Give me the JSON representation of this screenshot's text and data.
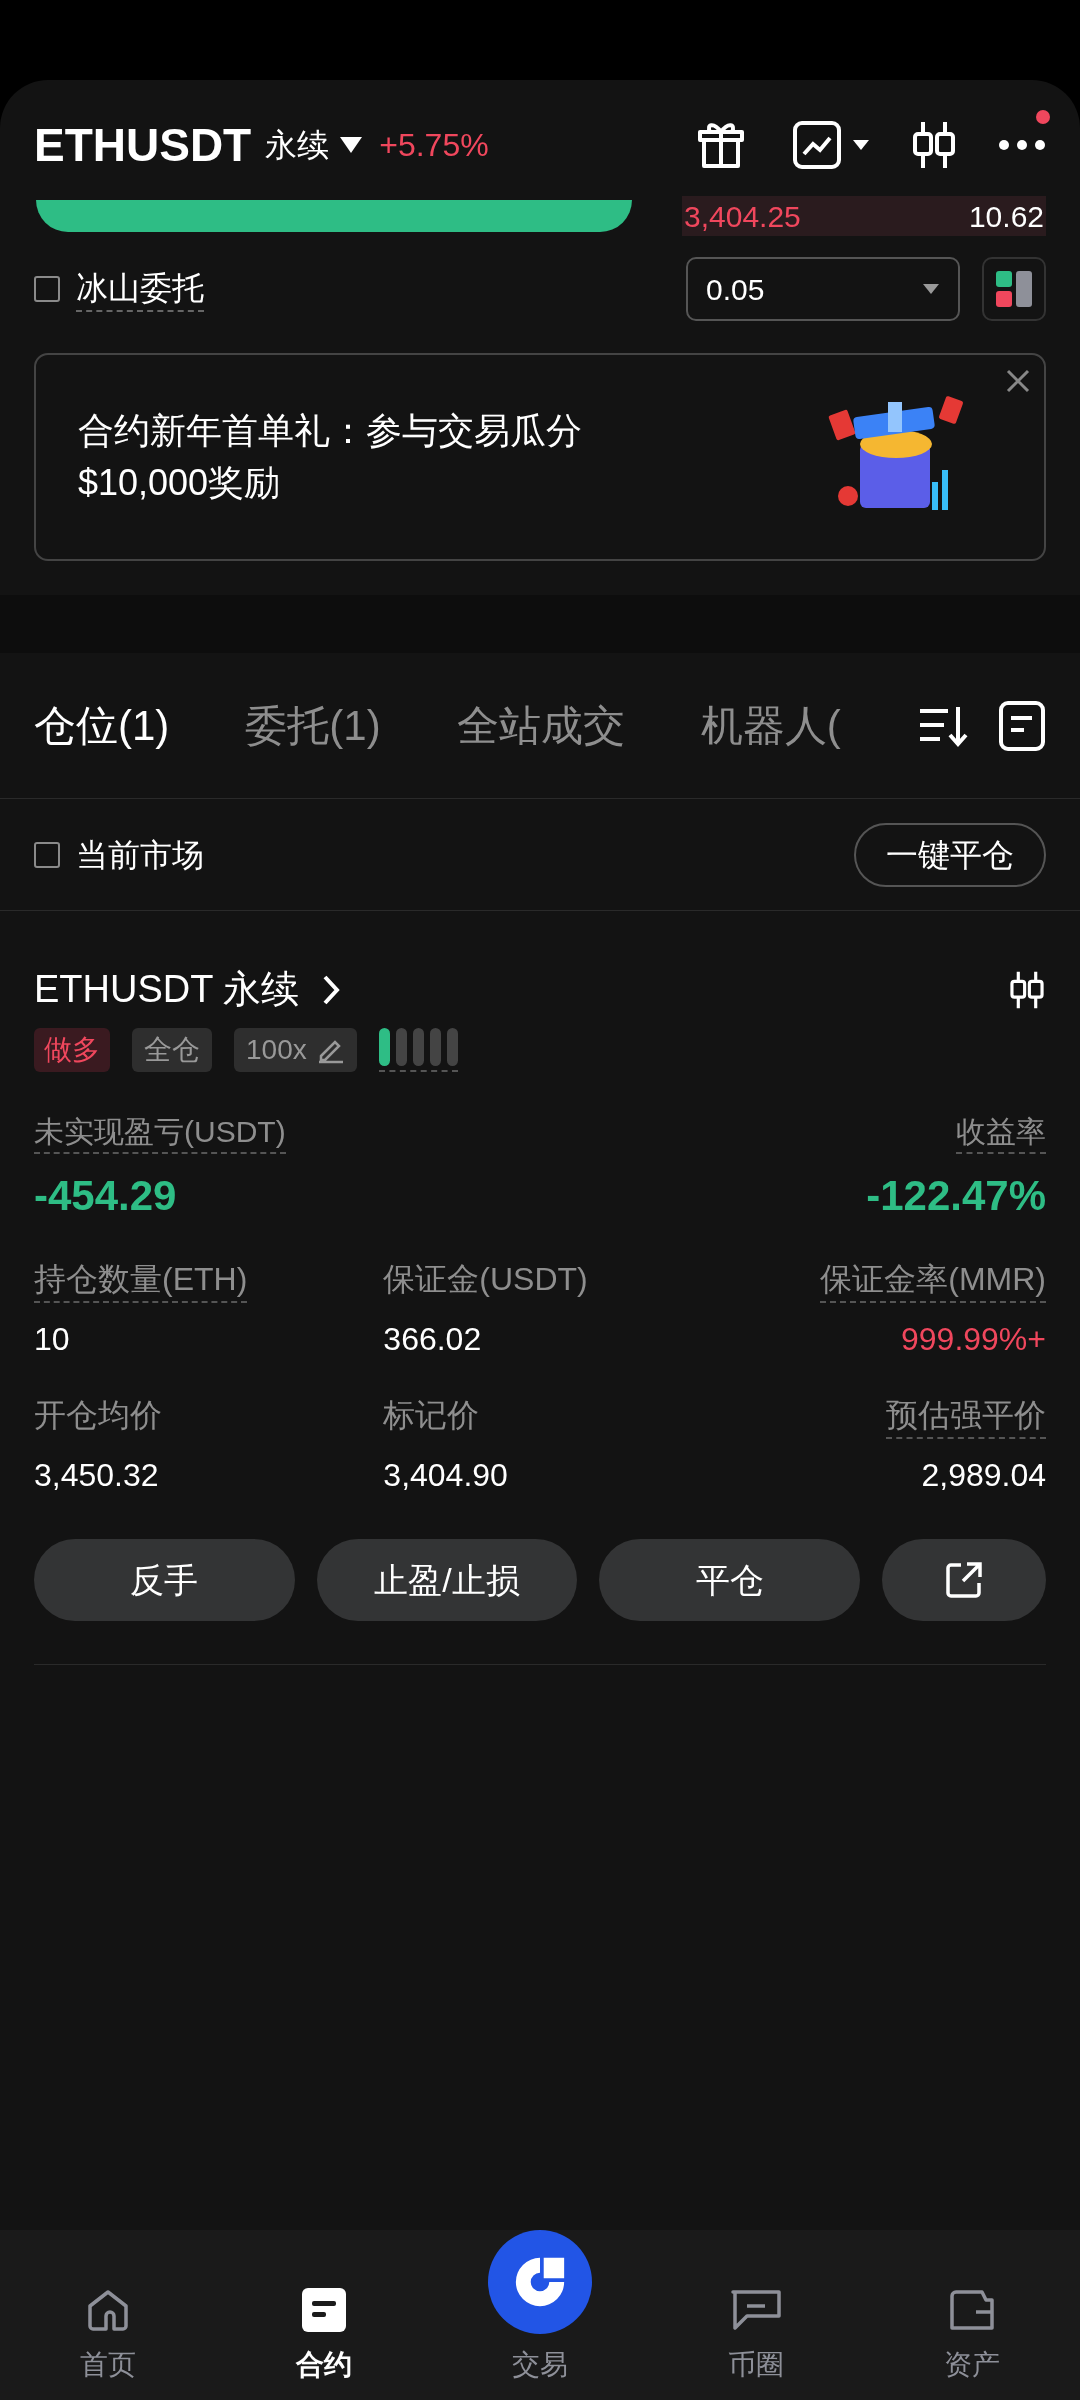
{
  "header": {
    "symbol": "ETHUSDT",
    "contract": "永续",
    "change": "+5.75%",
    "more_badge": true
  },
  "order_book": {
    "price": "3,404.25",
    "amount": "10.62"
  },
  "iceberg": {
    "label": "冰山委托",
    "checked": false
  },
  "precision": {
    "value": "0.05"
  },
  "banner": {
    "title": "合约新年首单礼：参与交易瓜分",
    "subtitle": "$10,000奖励"
  },
  "tabs": [
    {
      "label": "仓位(1)",
      "selected": true
    },
    {
      "label": "委托(1)",
      "selected": false
    },
    {
      "label": "全站成交",
      "selected": false
    },
    {
      "label": "机器人(",
      "selected": false
    }
  ],
  "filter": {
    "label": "当前市场",
    "checked": false
  },
  "close_all": "一键平仓",
  "position": {
    "symbol": "ETHUSDT 永续",
    "side": "做多",
    "margin_mode": "全仓",
    "leverage": "100x",
    "risk": [
      {
        "on": true
      },
      {
        "on": false
      },
      {
        "on": false
      },
      {
        "on": false
      },
      {
        "on": false
      }
    ],
    "pnl_label": "未实现盈亏(USDT)",
    "pnl": "-454.29",
    "roe_label": "收益率",
    "roe": "-122.47%",
    "stats": [
      {
        "label": "持仓数量(ETH)",
        "value": "10",
        "dashed": true,
        "warning": false
      },
      {
        "label": "保证金(USDT)",
        "value": "366.02",
        "dashed": false,
        "warning": false
      },
      {
        "label": "保证金率(MMR)",
        "value": "999.99%+",
        "dashed": true,
        "warning": true
      },
      {
        "label": "开仓均价",
        "value": "3,450.32",
        "dashed": false,
        "warning": false
      },
      {
        "label": "标记价",
        "value": "3,404.90",
        "dashed": false,
        "warning": false
      },
      {
        "label": "预估强平价",
        "value": "2,989.04",
        "dashed": true,
        "warning": false
      }
    ],
    "actions": [
      "反手",
      "止盈/止损",
      "平仓"
    ]
  },
  "nav": [
    {
      "label": "首页",
      "kind": "home",
      "selected": false
    },
    {
      "label": "合约",
      "kind": "futures",
      "selected": true
    },
    {
      "label": "交易",
      "kind": "trade",
      "selected": false
    },
    {
      "label": "币圈",
      "kind": "chat",
      "selected": false
    },
    {
      "label": "资产",
      "kind": "wallet",
      "selected": false
    }
  ]
}
